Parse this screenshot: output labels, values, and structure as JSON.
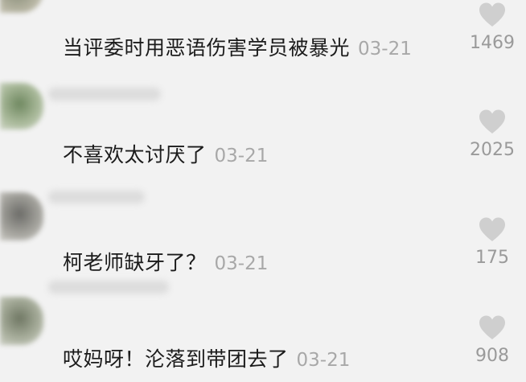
{
  "comments": [
    {
      "text": "当评委时用恶语伤害学员被暴光",
      "date": "03-21",
      "likes": "1469",
      "icon": "heart-icon"
    },
    {
      "text": "不喜欢太讨厌了",
      "date": "03-21",
      "likes": "2025",
      "icon": "heart-icon"
    },
    {
      "text": "柯老师缺牙了？",
      "date": "03-21",
      "likes": "175",
      "icon": "heart-icon"
    },
    {
      "text": "哎妈呀！沦落到带团去了",
      "date": "03-21",
      "likes": "908",
      "icon": "heart-icon"
    }
  ],
  "colors": {
    "background": "#f2f2f2",
    "text": "#1b1b1b",
    "meta": "#a8a8a8",
    "heart": "#cfcfcf"
  }
}
